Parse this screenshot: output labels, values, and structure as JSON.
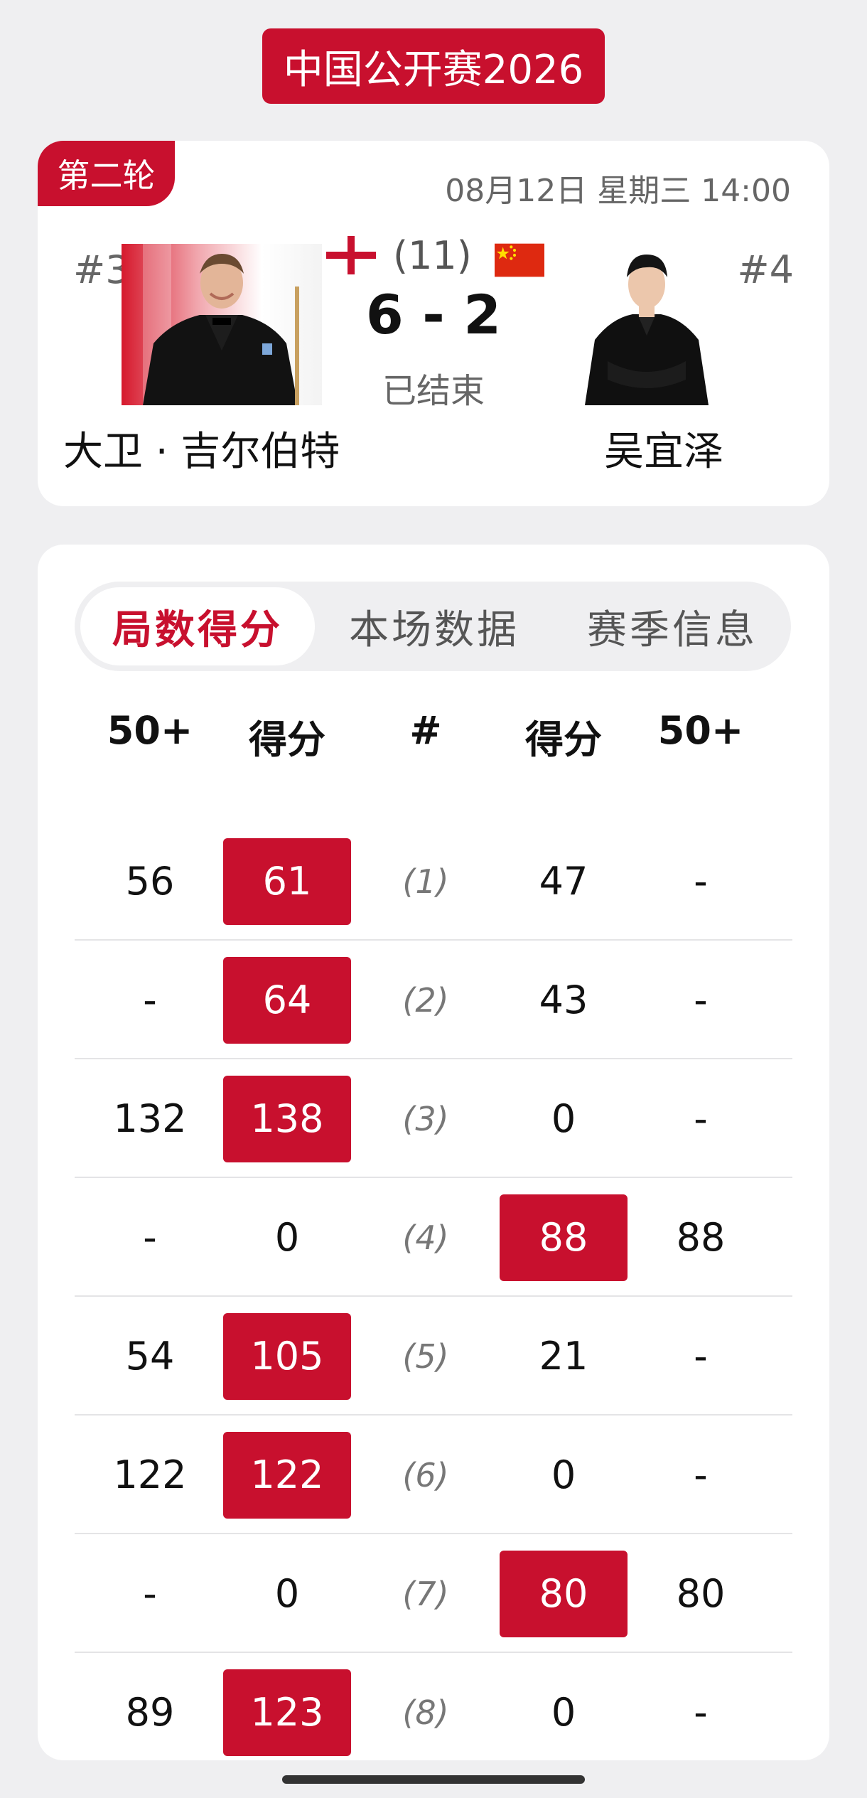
{
  "tournament": "中国公开赛2026",
  "match": {
    "round": "第二轮",
    "datetime": "08月12日 星期三 14:00",
    "left_player": {
      "seed": "#32",
      "name": "大卫 · 吉尔伯特",
      "flag": "england-flag-icon"
    },
    "right_player": {
      "seed": "#4",
      "name": "吴宜泽",
      "flag": "china-flag-icon"
    },
    "best_of": "(11)",
    "score": "6 - 2",
    "status": "已结束"
  },
  "tabs": [
    {
      "label": "局数得分",
      "active": true
    },
    {
      "label": "本场数据",
      "active": false
    },
    {
      "label": "赛季信息",
      "active": false
    }
  ],
  "headers": [
    "50+",
    "得分",
    "#",
    "得分",
    "50+"
  ],
  "frames": [
    {
      "l50": "56",
      "lscore": "61",
      "no": "(1)",
      "rscore": "47",
      "r50": "-",
      "winner": "left"
    },
    {
      "l50": "-",
      "lscore": "64",
      "no": "(2)",
      "rscore": "43",
      "r50": "-",
      "winner": "left"
    },
    {
      "l50": "132",
      "lscore": "138",
      "no": "(3)",
      "rscore": "0",
      "r50": "-",
      "winner": "left"
    },
    {
      "l50": "-",
      "lscore": "0",
      "no": "(4)",
      "rscore": "88",
      "r50": "88",
      "winner": "right"
    },
    {
      "l50": "54",
      "lscore": "105",
      "no": "(5)",
      "rscore": "21",
      "r50": "-",
      "winner": "left"
    },
    {
      "l50": "122",
      "lscore": "122",
      "no": "(6)",
      "rscore": "0",
      "r50": "-",
      "winner": "left"
    },
    {
      "l50": "-",
      "lscore": "0",
      "no": "(7)",
      "rscore": "80",
      "r50": "80",
      "winner": "right"
    },
    {
      "l50": "89",
      "lscore": "123",
      "no": "(8)",
      "rscore": "0",
      "r50": "-",
      "winner": "left"
    }
  ],
  "colors": {
    "accent": "#c8102e",
    "background": "#efeff1"
  }
}
